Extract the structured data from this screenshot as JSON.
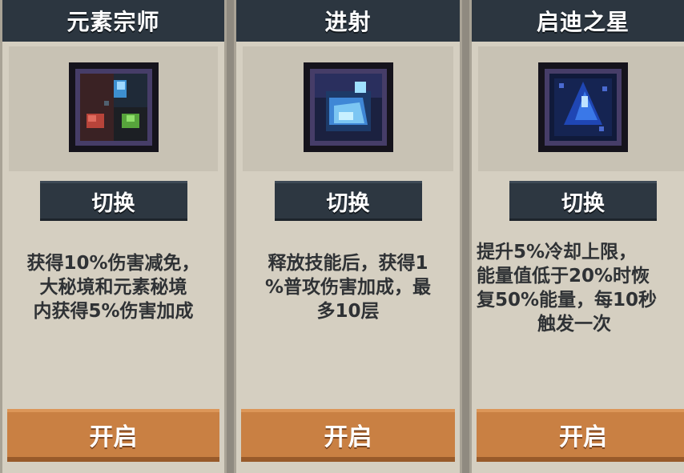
{
  "colors": {
    "header_bg": "#2c3640",
    "card_bg": "#d5cfc1",
    "switch_bg": "#2d3741",
    "open_bg": "#c98043",
    "icon_border": "#463d68"
  },
  "cards": [
    {
      "title": "元素宗师",
      "icon": "elemental-master-icon",
      "switch_label": "切换",
      "desc_lines": [
        "获得10%伤害减免，",
        "大秘境和元素秘境",
        "内获得5%伤害加成"
      ],
      "open_label": "开启"
    },
    {
      "title": "进射",
      "icon": "projectile-icon",
      "switch_label": "切换",
      "desc_lines": [
        "释放技能后，获得1",
        "%普攻伤害加成，最",
        "多10层"
      ],
      "open_label": "开启"
    },
    {
      "title": "启迪之星",
      "icon": "enlightenment-star-icon",
      "switch_label": "切换",
      "desc_lines": [
        "提升5%冷却上限，",
        "能量值低于20%时恢",
        "复50%能量，每10秒",
        "触发一次"
      ],
      "open_label": "开启"
    }
  ]
}
